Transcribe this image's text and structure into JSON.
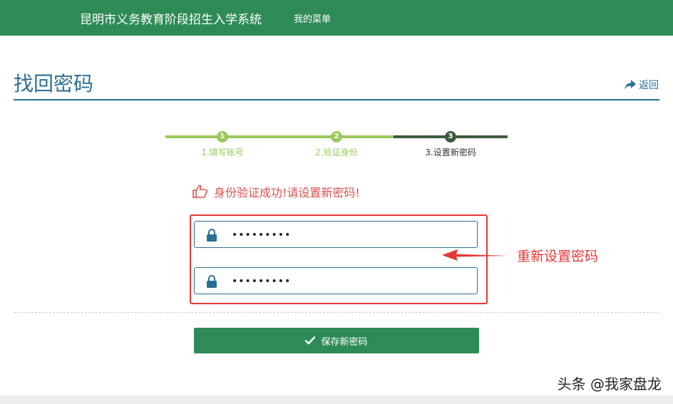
{
  "header": {
    "brand": "昆明市义务教育阶段招生入学系统",
    "menu": "我的菜单"
  },
  "page": {
    "title": "找回密码",
    "back": "返回"
  },
  "steps": [
    {
      "num": "1",
      "label": "1.填写账号",
      "state": "done"
    },
    {
      "num": "2",
      "label": "2.验证身份",
      "state": "done"
    },
    {
      "num": "3",
      "label": "3.设置新密码",
      "state": "current"
    }
  ],
  "colors": {
    "header": "#2e8b57",
    "done": "#9bc95b",
    "current": "#3d5a3d",
    "accent": "#2a6f97",
    "alert": "#e53935"
  },
  "success_message": "身份验证成功!请设置新密码!",
  "password": {
    "value": "•••••••••",
    "confirm": "•••••••••"
  },
  "icons": {
    "lock": "lock-icon",
    "thumb": "thumbs-up-icon",
    "back": "share-arrow-icon",
    "check": "check-icon"
  },
  "annotation": "重新设置密码",
  "save_button": "保存新密码",
  "watermark": "头条 @我家盘龙"
}
